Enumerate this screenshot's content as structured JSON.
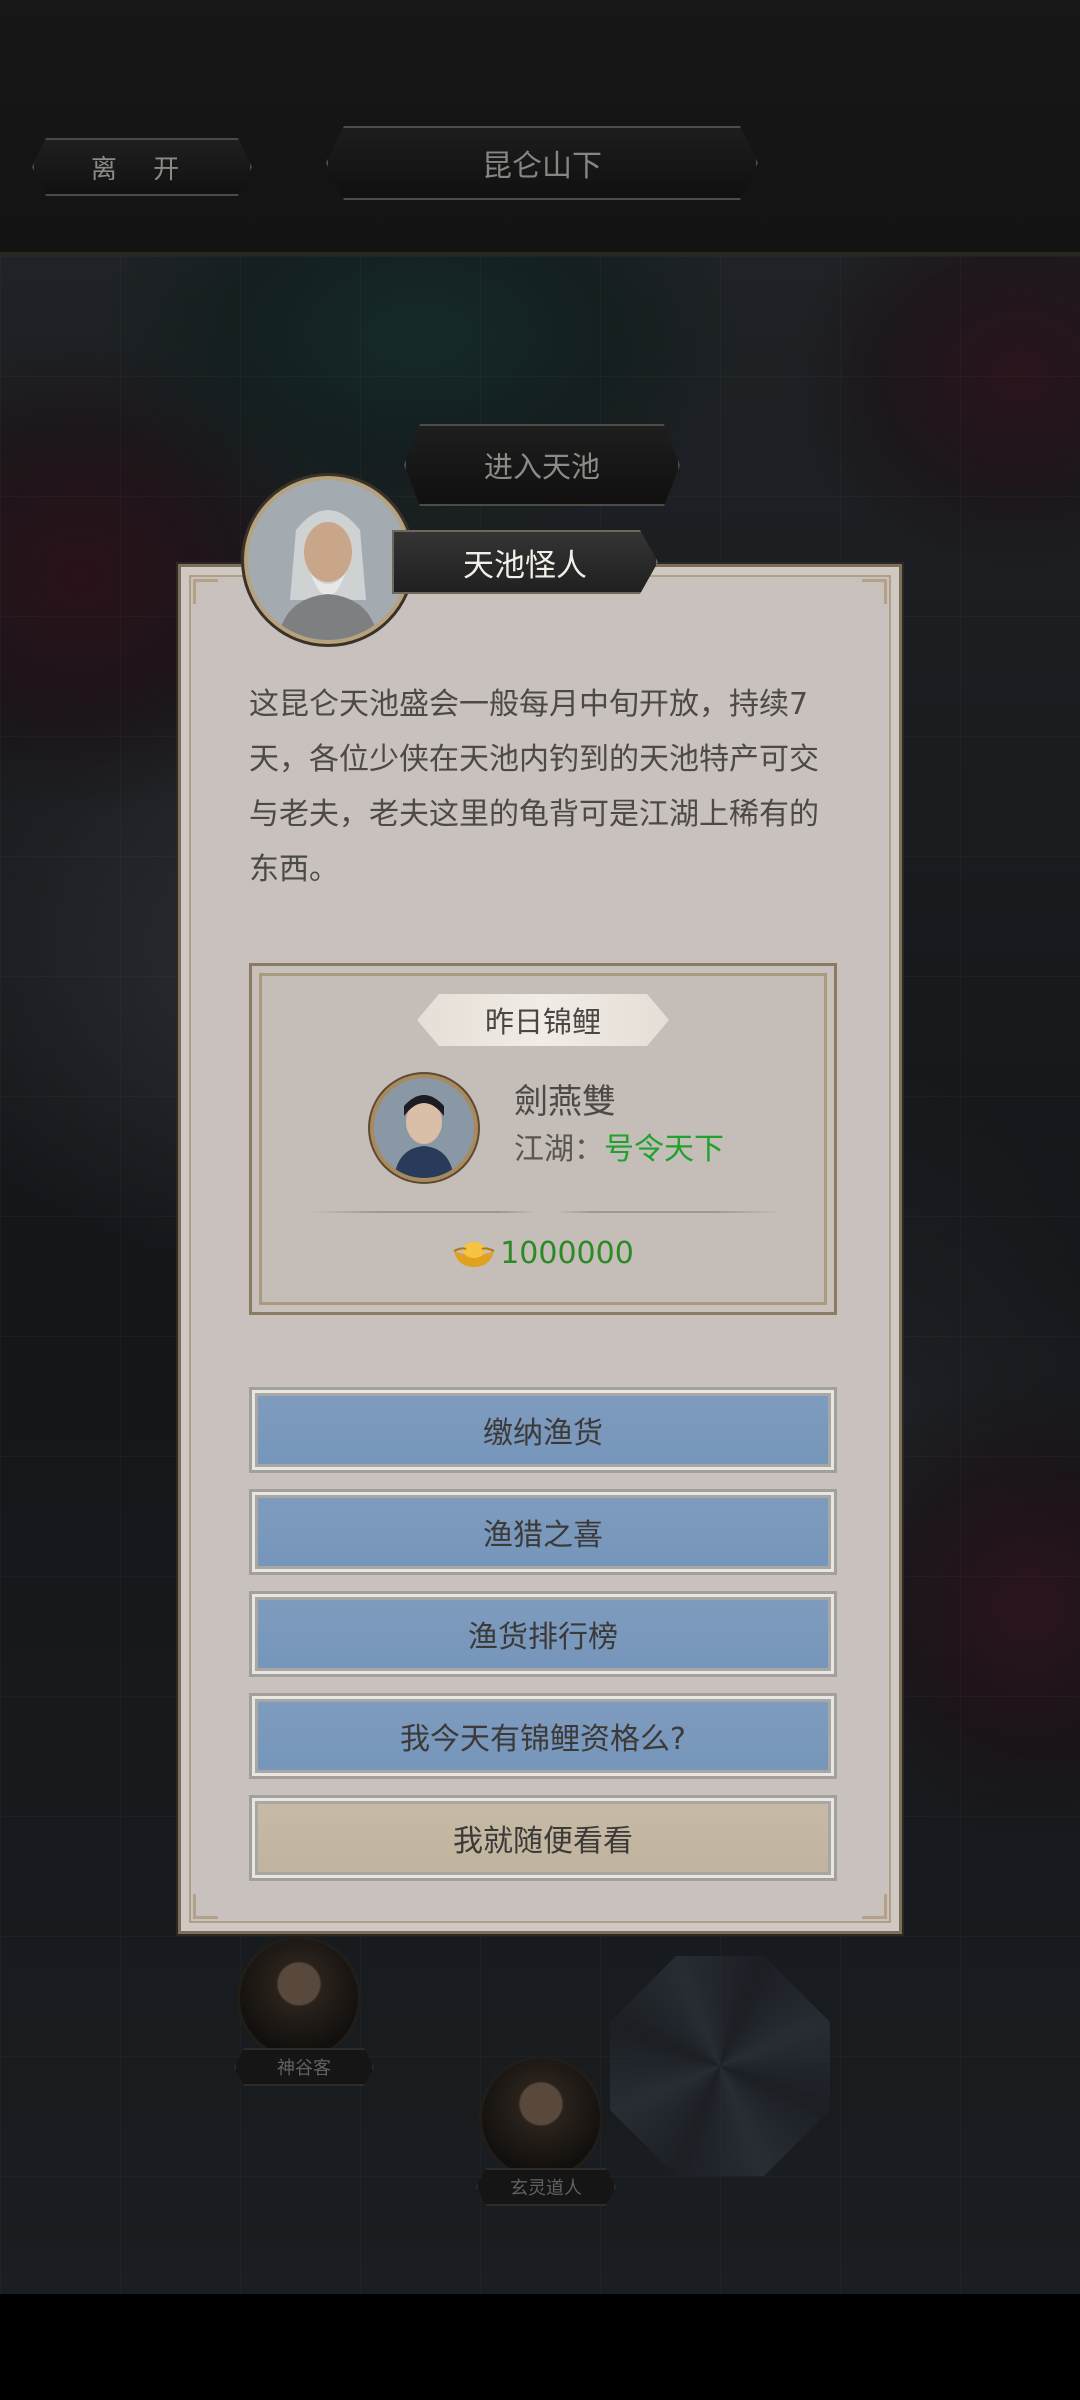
{
  "topbar": {
    "leave_label": "离 开",
    "location": "昆仑山下"
  },
  "map": {
    "enter_button": "进入天池",
    "npcs": [
      {
        "name": "神谷客"
      },
      {
        "name": "玄灵道人"
      }
    ]
  },
  "dialog": {
    "npc_name": "天池怪人",
    "text": "这昆仑天池盛会一般每月中旬开放，持续7天，各位少侠在天池内钓到的天池特产可交与老夫，老夫这里的龟背可是江湖上稀有的东西。",
    "koi": {
      "title": "昨日锦鲤",
      "player_name": "劍燕雙",
      "faction_label": "江湖：",
      "faction_value": "号令天下",
      "reward": "1000000"
    },
    "options": [
      {
        "label": "缴纳渔货",
        "style": "blue"
      },
      {
        "label": "渔猎之喜",
        "style": "blue"
      },
      {
        "label": "渔货排行榜",
        "style": "blue"
      },
      {
        "label": "我今天有锦鲤资格么?",
        "style": "blue"
      },
      {
        "label": "我就随便看看",
        "style": "beige"
      }
    ]
  },
  "colors": {
    "accent_green": "#1fa12d",
    "button_blue": "#7897bc",
    "button_beige": "#c3b7a1",
    "parchment": "#c9c1bd"
  }
}
